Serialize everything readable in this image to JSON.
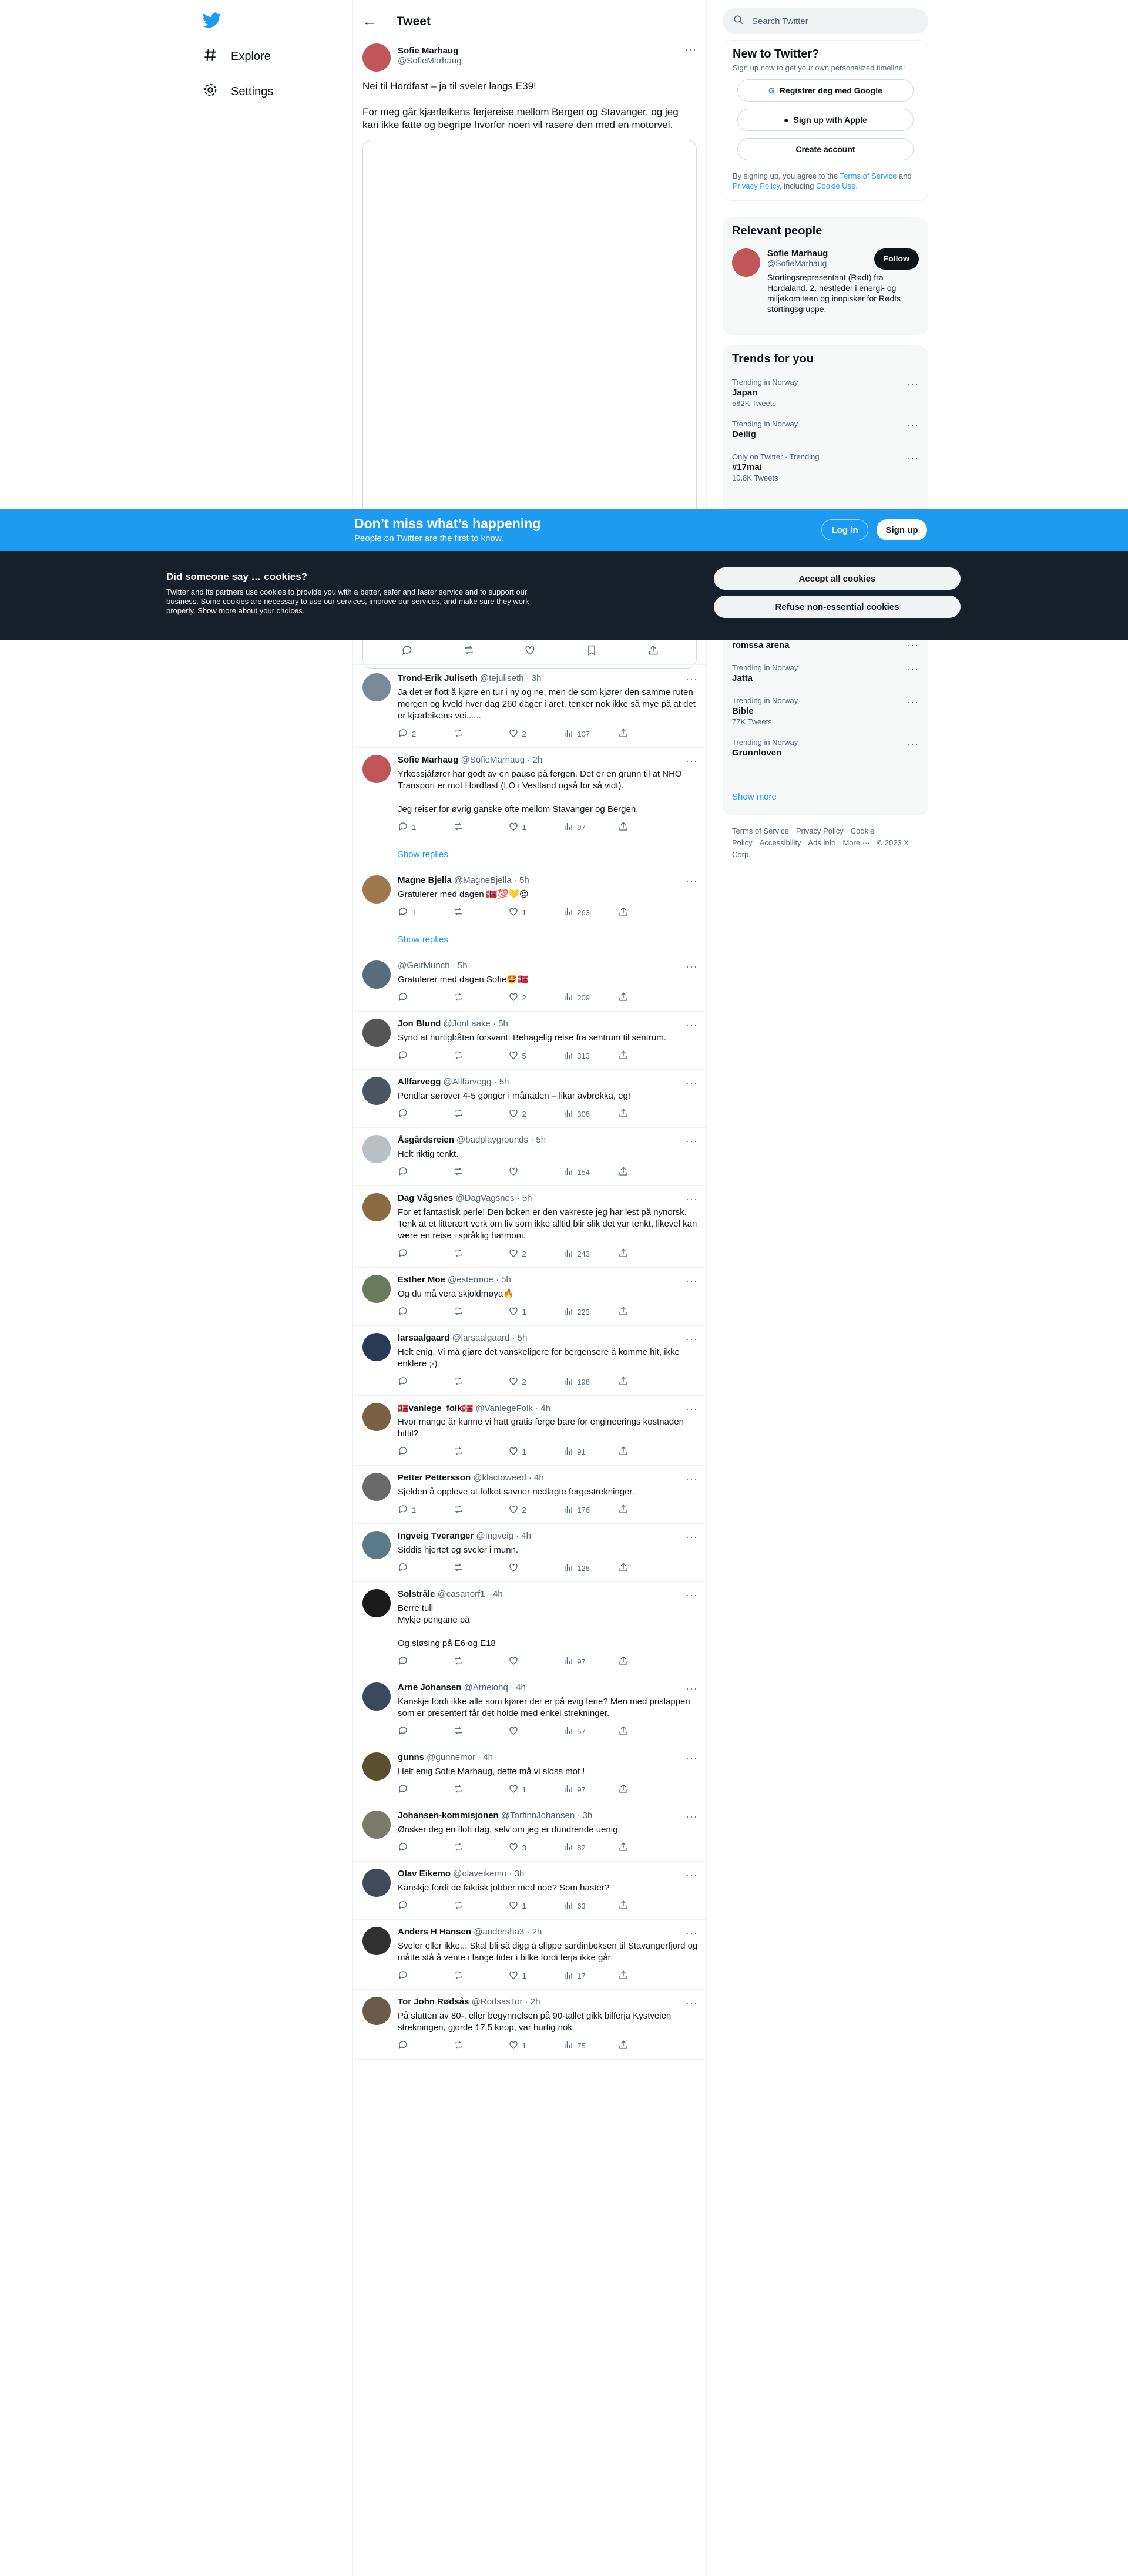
{
  "nav": {
    "items": [
      {
        "label": "Explore",
        "icon": "hashtag-icon"
      },
      {
        "label": "Settings",
        "icon": "gear-icon"
      }
    ]
  },
  "header": {
    "title": "Tweet"
  },
  "main_tweet": {
    "name": "Sofie Marhaug",
    "handle": "@SofieMarhaug",
    "text": "Nei til Hordfast – ja til sveler langs E39!\n\nFor meg går kjærleikens ferjereise mellom Bergen og Stavanger, og jeg kan ikke fatte og begripe hvorfor noen vil rasere den med en motorvei."
  },
  "search": {
    "placeholder": "Search Twitter"
  },
  "new_to_twitter": {
    "title": "New to Twitter?",
    "subtitle": "Sign up now to get your own personalized timeline!",
    "google": "Registrer deg med Google",
    "apple": "Sign up with Apple",
    "create": "Create account",
    "terms_prefix": "By signing up, you agree to the ",
    "terms_link": "Terms of Service",
    "terms_and": " and ",
    "privacy_link": "Privacy Policy",
    "terms_including": ", including ",
    "cookie_link": "Cookie Use",
    "terms_end": "."
  },
  "relevant_people": {
    "title": "Relevant people",
    "name": "Sofie Marhaug",
    "handle": "@SofieMarhaug",
    "bio": "Stortingsrepresentant (Rødt) fra Hordaland. 2. nestleder i energi- og miljøkomiteen og innpisker for Rødts stortingsgruppe.",
    "follow": "Follow"
  },
  "trends": {
    "title": "Trends for you",
    "top": [
      {
        "context": "Trending in Norway",
        "name": "Japan",
        "count": "582K Tweets"
      },
      {
        "context": "Trending in Norway",
        "name": "Deilig",
        "count": ""
      },
      {
        "context": "Only on Twitter · Trending",
        "name": "#17mai",
        "count": "10.8K Tweets"
      }
    ],
    "bottom": [
      {
        "context": "",
        "name": "romssa arena",
        "count": ""
      },
      {
        "context": "Trending in Norway",
        "name": "Jatta",
        "count": ""
      },
      {
        "context": "Trending in Norway",
        "name": "Bible",
        "count": "77K Tweets"
      },
      {
        "context": "Trending in Norway",
        "name": "Grunnloven",
        "count": ""
      }
    ],
    "show_more": "Show more"
  },
  "footer": {
    "links": [
      "Terms of Service",
      "Privacy Policy",
      "Cookie Policy",
      "Accessibility",
      "Ads info",
      "More ···",
      "© 2023 X Corp."
    ]
  },
  "banner": {
    "title": "Don’t miss what’s happening",
    "subtitle": "People on Twitter are the first to know.",
    "login": "Log in",
    "signup": "Sign up"
  },
  "cookie": {
    "title": "Did someone say … cookies?",
    "text": "Twitter and its partners use cookies to provide you with a better, safer and faster service and to support our business. Some cookies are necessary to use our services, improve our services, and make sure they work properly. ",
    "link": "Show more about your choices.",
    "accept": "Accept all cookies",
    "refuse": "Refuse non-essential cookies"
  },
  "replies": [
    {
      "name": "Trond-Erik Juliseth",
      "handle": "@tejuliseth",
      "time": "3h",
      "text": "Ja det er flott å kjøre en tur i ny og ne, men de som kjører den samme ruten morgen og kveld hver dag 260 dager i året, tenker nok ikke så mye på at det er kjærleikens vei......",
      "replies": "2",
      "retweets": "",
      "likes": "2",
      "views": "107",
      "avatar": "#7a8a99",
      "show_replies": ""
    },
    {
      "name": "Sofie Marhaug",
      "handle": "@SofieMarhaug",
      "time": "2h",
      "text": "Yrkessjåfører har godt av en pause på fergen. Det er en grunn til at NHO Transport er mot Hordfast (LO i Vestland også for så vidt).\n\nJeg reiser for øvrig ganske ofte mellom Stavanger og Bergen.",
      "replies": "1",
      "retweets": "",
      "likes": "1",
      "views": "97",
      "avatar": "#c0555a",
      "show_replies": "Show replies"
    },
    {
      "name": "Magne Bjella",
      "handle": "@MagneBjella",
      "time": "5h",
      "text": "Gratulerer med dagen 🇳🇴💯💛😍",
      "replies": "1",
      "retweets": "",
      "likes": "1",
      "views": "263",
      "avatar": "#a07850",
      "show_replies": "Show replies"
    },
    {
      "name": "",
      "handle": "@GeirMunch",
      "time": "5h",
      "text": "Gratulerer med dagen Sofie🤩🇳🇴",
      "replies": "",
      "retweets": "",
      "likes": "2",
      "views": "209",
      "avatar": "#5a6b7a",
      "show_replies": ""
    },
    {
      "name": "Jon Blund",
      "handle": "@JonLaake",
      "time": "5h",
      "text": "Synd at hurtigbåten forsvant. Behagelig reise fra sentrum til sentrum.",
      "replies": "",
      "retweets": "",
      "likes": "5",
      "views": "313",
      "avatar": "#555555",
      "show_replies": ""
    },
    {
      "name": "Allfarvegg",
      "handle": "@Allfarvegg",
      "time": "5h",
      "text": "Pendlar sørover 4-5 gonger i månaden – likar avbrekka, eg!",
      "replies": "",
      "retweets": "",
      "likes": "2",
      "views": "308",
      "avatar": "#4a5560",
      "show_replies": ""
    },
    {
      "name": "Åsgårdsreien",
      "handle": "@badplaygrounds",
      "time": "5h",
      "text": "Helt riktig tenkt.",
      "replies": "",
      "retweets": "",
      "likes": "",
      "views": "154",
      "avatar": "#b8c0c6",
      "show_replies": ""
    },
    {
      "name": "Dag Vågsnes",
      "handle": "@DagVagsnes",
      "time": "5h",
      "text": "For et fantastisk perle! Den boken er den vakreste jeg har lest på nynorsk. Tenk at et litterært verk om liv som ikke alltid blir slik det var tenkt, likevel kan være en reise i språklig harmoni.",
      "replies": "",
      "retweets": "",
      "likes": "2",
      "views": "243",
      "avatar": "#8a6a40",
      "show_replies": ""
    },
    {
      "name": "Esther Moe",
      "handle": "@estermoe",
      "time": "5h",
      "text": "Og du må vera skjoldmøya🔥",
      "replies": "",
      "retweets": "",
      "likes": "1",
      "views": "223",
      "avatar": "#6a7a5a",
      "show_replies": ""
    },
    {
      "name": "larsaalgaard",
      "handle": "@larsaalgaard",
      "time": "5h",
      "text": "Helt enig. Vi må gjøre det vanskeligere for bergensere å komme hit, ikke enklere ;-)",
      "replies": "",
      "retweets": "",
      "likes": "2",
      "views": "198",
      "avatar": "#2a3a55",
      "show_replies": ""
    },
    {
      "name": "🇳🇴vanlege_folk🇳🇴",
      "handle": "@VanlegeFolk",
      "time": "4h",
      "text": "Hvor mange år kunne vi hatt gratis ferge bare for engineerings kostnaden hittil?",
      "replies": "",
      "retweets": "",
      "likes": "1",
      "views": "91",
      "avatar": "#7a6040",
      "show_replies": ""
    },
    {
      "name": "Petter Pettersson",
      "handle": "@klactoweed",
      "time": "4h",
      "text": "Sjelden å oppleve at folket savner nedlagte fergestrekninger.",
      "replies": "1",
      "retweets": "",
      "likes": "2",
      "views": "176",
      "avatar": "#6a6a6a",
      "show_replies": ""
    },
    {
      "name": "Ingveig Tveranger",
      "handle": "@Ingveig",
      "time": "4h",
      "text": "Siddis hjertet og sveler i munn.",
      "replies": "",
      "retweets": "",
      "likes": "",
      "views": "128",
      "avatar": "#5a7a8a",
      "show_replies": ""
    },
    {
      "name": "Solstråle",
      "handle": "@casanorf1",
      "time": "4h",
      "text": "Berre tull\nMykje pengane på\n\nOg sløsing på E6 og E18",
      "replies": "",
      "retweets": "",
      "likes": "",
      "views": "97",
      "avatar": "#1a1a1a",
      "show_replies": ""
    },
    {
      "name": "Arne Johansen",
      "handle": "@Arneiohq",
      "time": "4h",
      "text": "Kanskje fordi ikke alle som kjører der er på evig ferie? Men med prislappen som er presentert får det holde med enkel strekninger.",
      "replies": "",
      "retweets": "",
      "likes": "",
      "views": "57",
      "avatar": "#3a4a5a",
      "show_replies": ""
    },
    {
      "name": "gunns",
      "handle": "@gunnemor",
      "time": "4h",
      "text": "Helt enig Sofie Marhaug, dette må vi sloss mot !",
      "replies": "",
      "retweets": "",
      "likes": "1",
      "views": "97",
      "avatar": "#5a5030",
      "show_replies": ""
    },
    {
      "name": "Johansen-kommisjonen",
      "handle": "@TorfinnJohansen",
      "time": "3h",
      "text": "Ønsker deg en flott dag, selv om jeg er dundrende uenig.",
      "replies": "",
      "retweets": "",
      "likes": "3",
      "views": "82",
      "avatar": "#7a7a6a",
      "show_replies": ""
    },
    {
      "name": "Olav Eikemo",
      "handle": "@olaveikemo",
      "time": "3h",
      "text": "Kanskje fordi de faktisk jobber med noe? Som haster?",
      "replies": "",
      "retweets": "",
      "likes": "1",
      "views": "63",
      "avatar": "#404a5a",
      "show_replies": ""
    },
    {
      "name": "Anders H Hansen",
      "handle": "@andersha3",
      "time": "2h",
      "text": "Sveler eller ikke... Skal bli så digg å slippe sardinboksen til Stavangerfjord og måtte stå å vente i lange tider i bilke fordi ferja ikke går",
      "replies": "",
      "retweets": "",
      "likes": "1",
      "views": "17",
      "avatar": "#303030",
      "show_replies": ""
    },
    {
      "name": "Tor John Rødsås",
      "handle": "@RodsasTor",
      "time": "2h",
      "text": "På slutten av 80-, eller begynnelsen på 90-tallet gikk bilferja Kystveien strekningen, gjorde 17,5 knop, var hurtig nok",
      "replies": "",
      "retweets": "",
      "likes": "1",
      "views": "75",
      "avatar": "#6a5a4a",
      "show_replies": ""
    }
  ]
}
